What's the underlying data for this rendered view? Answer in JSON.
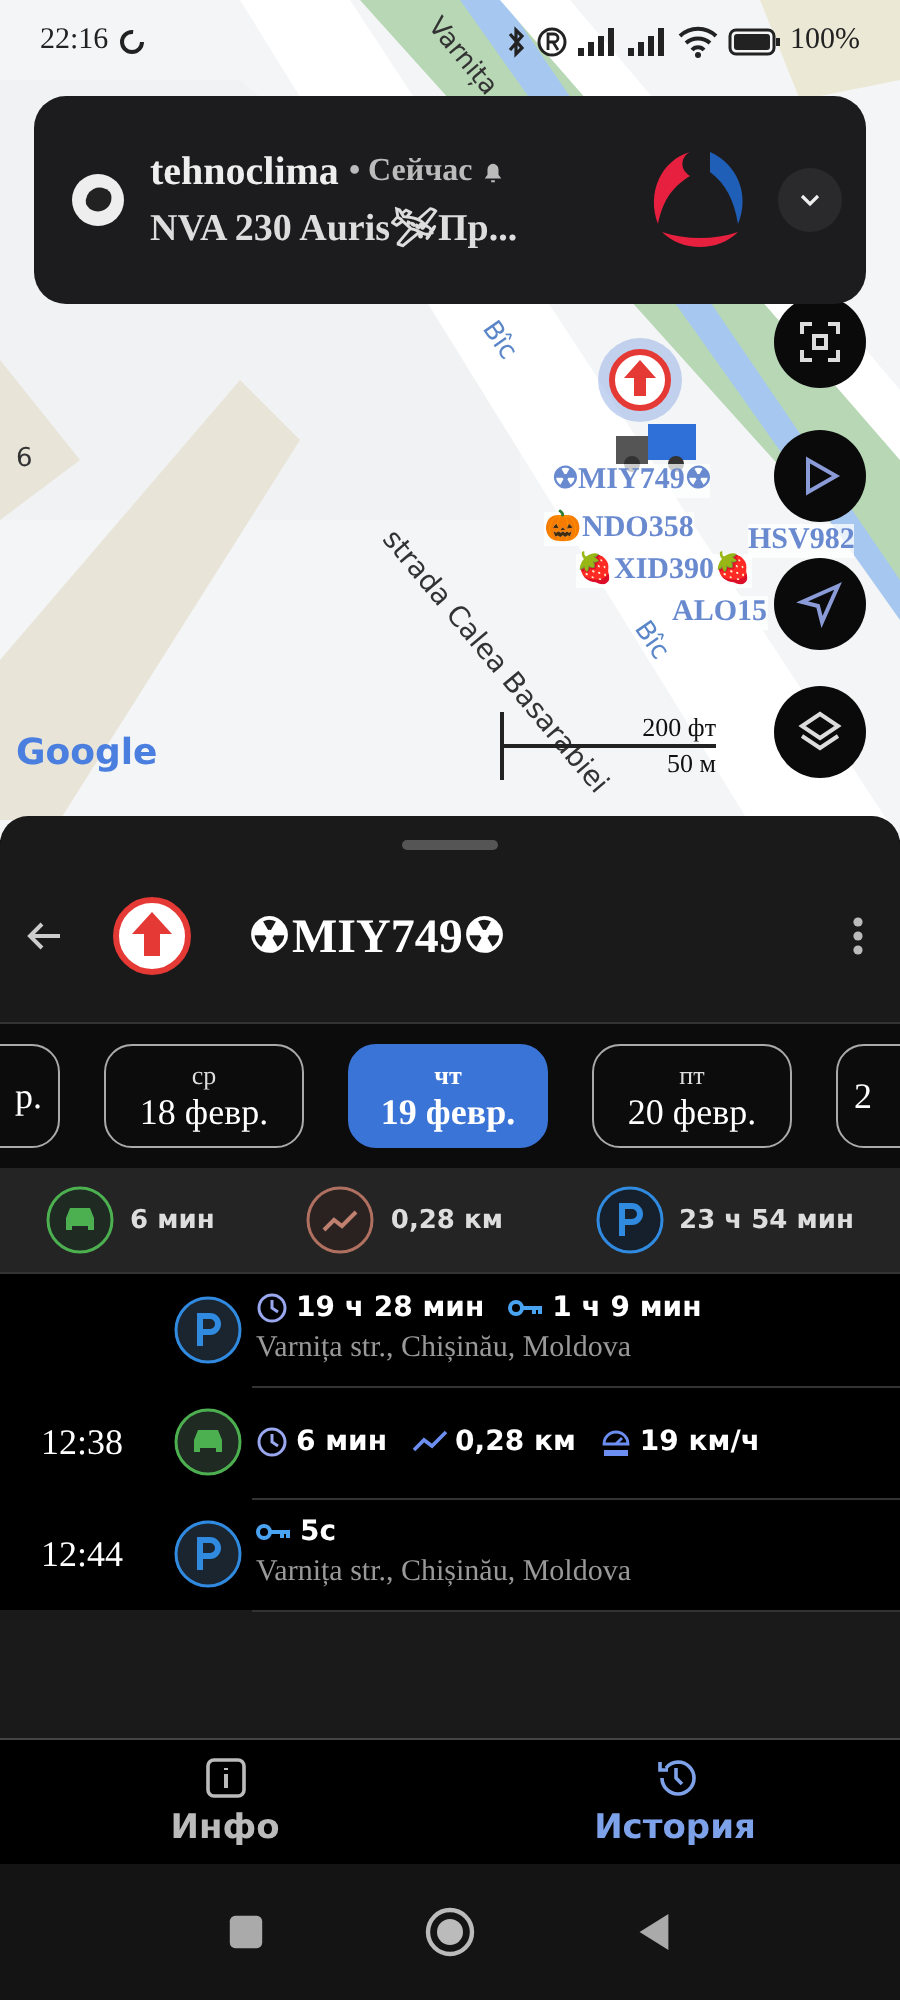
{
  "status_bar": {
    "time": "22:16",
    "battery": "100%"
  },
  "notification": {
    "app": "tehnoclima",
    "time": "• Сейчас",
    "text": "NVA 230 Auris🛩Пр..."
  },
  "map": {
    "street_labels": [
      {
        "text": "Varnița",
        "kind": "top"
      },
      {
        "text": "Bîc",
        "kind": "river1"
      },
      {
        "text": "strada Calea Basarabiei",
        "kind": "main"
      },
      {
        "text": "Bîc",
        "kind": "river2"
      },
      {
        "text": "6",
        "kind": "house"
      }
    ],
    "vehicles": [
      {
        "label": "☢MIY749☢"
      },
      {
        "label": "🎃NDO358"
      },
      {
        "label": "🍓XID390🍓"
      },
      {
        "label": "HSV982"
      },
      {
        "label": "ALO15"
      }
    ],
    "scale": {
      "feet": "200 фт",
      "meters": "50 м"
    },
    "attribution": "Google"
  },
  "sheet": {
    "title": "☢MIY749☢",
    "days": [
      {
        "date": "р.",
        "selected": false
      },
      {
        "weekday": "ср",
        "date": "18 февр.",
        "selected": false
      },
      {
        "weekday": "чт",
        "date": "19 февр.",
        "selected": true
      },
      {
        "weekday": "пт",
        "date": "20 февр.",
        "selected": false
      },
      {
        "date": "2",
        "selected": false
      }
    ],
    "summary": [
      {
        "kind": "drive",
        "value": "6 мин"
      },
      {
        "kind": "distance",
        "value": "0,28 км"
      },
      {
        "kind": "parking",
        "value": "23 ч 54 мин"
      }
    ],
    "events": [
      {
        "kind": "parking",
        "duration": "19 ч 28 мин",
        "engine": "1 ч 9 мин",
        "address": "Varnița str., Chișinău, Moldova"
      },
      {
        "kind": "drive",
        "time": "12:38",
        "duration": "6 мин",
        "distance": "0,28 км",
        "max_speed": "19 км/ч"
      },
      {
        "kind": "parking",
        "time": "12:44",
        "engine": "5с",
        "address": "Varnița str., Chișinău, Moldova"
      }
    ]
  },
  "bottom_nav": [
    {
      "label": "Инфо",
      "kind": "info",
      "selected": false
    },
    {
      "label": "История",
      "kind": "history",
      "selected": true
    }
  ]
}
